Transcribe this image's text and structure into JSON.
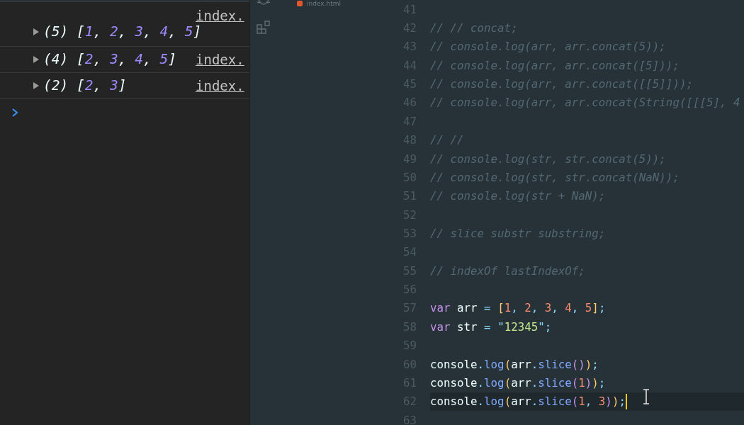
{
  "console": {
    "messages": [
      {
        "kind": "wrapped",
        "link": "index.",
        "parts": [
          {
            "text": "(5) [",
            "kind": "plain"
          },
          {
            "text": "1",
            "kind": "number"
          },
          {
            "text": ", ",
            "kind": "plain"
          },
          {
            "text": "2",
            "kind": "number"
          },
          {
            "text": ", ",
            "kind": "plain"
          },
          {
            "text": "3",
            "kind": "number"
          },
          {
            "text": ", ",
            "kind": "plain"
          },
          {
            "text": "4",
            "kind": "number"
          },
          {
            "text": ", ",
            "kind": "plain"
          },
          {
            "text": "5",
            "kind": "number"
          },
          {
            "text": "]",
            "kind": "plain"
          }
        ]
      },
      {
        "kind": "inline",
        "link": "index.",
        "parts": [
          {
            "text": "(4) [",
            "kind": "plain"
          },
          {
            "text": "2",
            "kind": "number"
          },
          {
            "text": ", ",
            "kind": "plain"
          },
          {
            "text": "3",
            "kind": "number"
          },
          {
            "text": ", ",
            "kind": "plain"
          },
          {
            "text": "4",
            "kind": "number"
          },
          {
            "text": ", ",
            "kind": "plain"
          },
          {
            "text": "5",
            "kind": "number"
          },
          {
            "text": "]",
            "kind": "plain"
          }
        ]
      },
      {
        "kind": "inline",
        "link": "index.",
        "parts": [
          {
            "text": "(2) [",
            "kind": "plain"
          },
          {
            "text": "2",
            "kind": "number"
          },
          {
            "text": ", ",
            "kind": "plain"
          },
          {
            "text": "3",
            "kind": "number"
          },
          {
            "text": "]",
            "kind": "plain"
          }
        ]
      }
    ]
  },
  "editor": {
    "tab": {
      "label": "index.html"
    },
    "lines": [
      {
        "number": "41",
        "current": false
      },
      {
        "number": "42",
        "current": false,
        "tokens": [
          {
            "text": "// // concat;",
            "kind": "comment"
          }
        ]
      },
      {
        "number": "43",
        "current": false,
        "tokens": [
          {
            "text": "// console.log(arr, arr.concat(5));",
            "kind": "comment"
          }
        ]
      },
      {
        "number": "44",
        "current": false,
        "tokens": [
          {
            "text": "// console.log(arr, arr.concat([5]));",
            "kind": "comment"
          }
        ]
      },
      {
        "number": "45",
        "current": false,
        "tokens": [
          {
            "text": "// console.log(arr, arr.concat([[5]]));",
            "kind": "comment"
          }
        ]
      },
      {
        "number": "46",
        "current": false,
        "tokens": [
          {
            "text": "// console.log(arr, arr.concat(String([[[5], 4",
            "kind": "comment"
          }
        ]
      },
      {
        "number": "47",
        "current": false
      },
      {
        "number": "48",
        "current": false,
        "tokens": [
          {
            "text": "// //",
            "kind": "comment"
          }
        ]
      },
      {
        "number": "49",
        "current": false,
        "tokens": [
          {
            "text": "// console.log(str, str.concat(5));",
            "kind": "comment"
          }
        ]
      },
      {
        "number": "50",
        "current": false,
        "tokens": [
          {
            "text": "// console.log(str, str.concat(NaN));",
            "kind": "comment"
          }
        ]
      },
      {
        "number": "51",
        "current": false,
        "tokens": [
          {
            "text": "// console.log(str + NaN);",
            "kind": "comment"
          }
        ]
      },
      {
        "number": "52",
        "current": false
      },
      {
        "number": "53",
        "current": false,
        "tokens": [
          {
            "text": "// slice substr substring;",
            "kind": "comment"
          }
        ]
      },
      {
        "number": "54",
        "current": false
      },
      {
        "number": "55",
        "current": false,
        "tokens": [
          {
            "text": "// indexOf lastIndexOf;",
            "kind": "comment"
          }
        ]
      },
      {
        "number": "56",
        "current": false
      },
      {
        "number": "57",
        "current": false,
        "tokens": [
          {
            "text": "var",
            "kind": "keyword"
          },
          {
            "text": " arr",
            "kind": "plain"
          },
          {
            "text": " = ",
            "kind": "op"
          },
          {
            "text": "[",
            "kind": "bracket"
          },
          {
            "text": "1",
            "kind": "number"
          },
          {
            "text": ", ",
            "kind": "op"
          },
          {
            "text": "2",
            "kind": "number"
          },
          {
            "text": ", ",
            "kind": "op"
          },
          {
            "text": "3",
            "kind": "number"
          },
          {
            "text": ", ",
            "kind": "op"
          },
          {
            "text": "4",
            "kind": "number"
          },
          {
            "text": ", ",
            "kind": "op"
          },
          {
            "text": "5",
            "kind": "number"
          },
          {
            "text": "]",
            "kind": "bracket"
          },
          {
            "text": ";",
            "kind": "op"
          }
        ]
      },
      {
        "number": "58",
        "current": false,
        "tokens": [
          {
            "text": "var",
            "kind": "keyword"
          },
          {
            "text": " str",
            "kind": "plain"
          },
          {
            "text": " = \"",
            "kind": "op"
          },
          {
            "text": "12345",
            "kind": "string"
          },
          {
            "text": "\";",
            "kind": "op"
          }
        ]
      },
      {
        "number": "59",
        "current": false
      },
      {
        "number": "60",
        "current": false,
        "tokens": [
          {
            "text": "console",
            "kind": "plain"
          },
          {
            "text": ".",
            "kind": "op"
          },
          {
            "text": "log",
            "kind": "func"
          },
          {
            "text": "(",
            "kind": "bracket"
          },
          {
            "text": "arr",
            "kind": "plain"
          },
          {
            "text": ".",
            "kind": "op"
          },
          {
            "text": "slice",
            "kind": "func"
          },
          {
            "text": "()",
            "kind": "paren"
          },
          {
            "text": ")",
            "kind": "bracket"
          },
          {
            "text": ";",
            "kind": "op"
          }
        ]
      },
      {
        "number": "61",
        "current": false,
        "tokens": [
          {
            "text": "console",
            "kind": "plain"
          },
          {
            "text": ".",
            "kind": "op"
          },
          {
            "text": "log",
            "kind": "func"
          },
          {
            "text": "(",
            "kind": "bracket"
          },
          {
            "text": "arr",
            "kind": "plain"
          },
          {
            "text": ".",
            "kind": "op"
          },
          {
            "text": "slice",
            "kind": "func"
          },
          {
            "text": "(",
            "kind": "paren"
          },
          {
            "text": "1",
            "kind": "number"
          },
          {
            "text": ")",
            "kind": "paren"
          },
          {
            "text": ")",
            "kind": "bracket"
          },
          {
            "text": ";",
            "kind": "op"
          }
        ]
      },
      {
        "number": "62",
        "current": true,
        "tokens": [
          {
            "text": "console",
            "kind": "plain"
          },
          {
            "text": ".",
            "kind": "op"
          },
          {
            "text": "log",
            "kind": "func"
          },
          {
            "text": "(",
            "kind": "bracket"
          },
          {
            "text": "arr",
            "kind": "plain"
          },
          {
            "text": ".",
            "kind": "op"
          },
          {
            "text": "slice",
            "kind": "func"
          },
          {
            "text": "(",
            "kind": "paren"
          },
          {
            "text": "1",
            "kind": "number"
          },
          {
            "text": ", ",
            "kind": "op"
          },
          {
            "text": "3",
            "kind": "number"
          },
          {
            "text": ")",
            "kind": "paren"
          },
          {
            "text": ")",
            "kind": "bracket"
          },
          {
            "text": ";",
            "kind": "op"
          }
        ]
      },
      {
        "number": "63",
        "current": false
      }
    ]
  }
}
